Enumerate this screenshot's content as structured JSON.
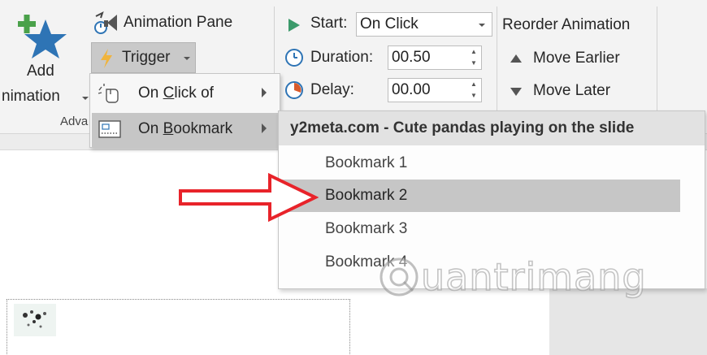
{
  "ribbon": {
    "add_animation_line1": "Add",
    "add_animation_line2": "nimation",
    "group_advanced": "Adva",
    "animation_pane": "Animation Pane",
    "trigger": "Trigger",
    "start_label": "Start:",
    "start_value": "On Click",
    "duration_label": "Duration:",
    "duration_value": "00.50",
    "delay_label": "Delay:",
    "delay_value": "00.00",
    "reorder_title": "Reorder Animation",
    "move_earlier": "Move Earlier",
    "move_later": "Move Later"
  },
  "trigger_menu": {
    "items": [
      {
        "label_pre": "On ",
        "label_accel": "C",
        "label_post": "lick of"
      },
      {
        "label_pre": "On ",
        "label_accel": "B",
        "label_post": "ookmark"
      }
    ]
  },
  "bookmark_menu": {
    "header": "y2meta.com - Cute pandas playing on the slide",
    "items": [
      "Bookmark 1",
      "Bookmark 2",
      "Bookmark 3",
      "Bookmark 4"
    ],
    "selected_index": 1
  },
  "watermark": {
    "text": "uantrimang"
  },
  "colors": {
    "accent_blue": "#2e74b5",
    "add_green": "#4aa14a",
    "play_green": "#3c9a6b",
    "arrow_red": "#e8232a",
    "trigger_lightning": "#f0b43c",
    "highlight_gray": "#c6c6c6"
  },
  "icons": {
    "add_animation": "star-plus-icon",
    "animation_pane": "animation-pane-icon",
    "trigger": "lightning-icon",
    "start": "play-triangle-icon",
    "duration": "clock-icon",
    "delay": "delay-pie-icon",
    "on_click_of": "mouse-click-icon",
    "on_bookmark": "bookmark-media-icon"
  }
}
